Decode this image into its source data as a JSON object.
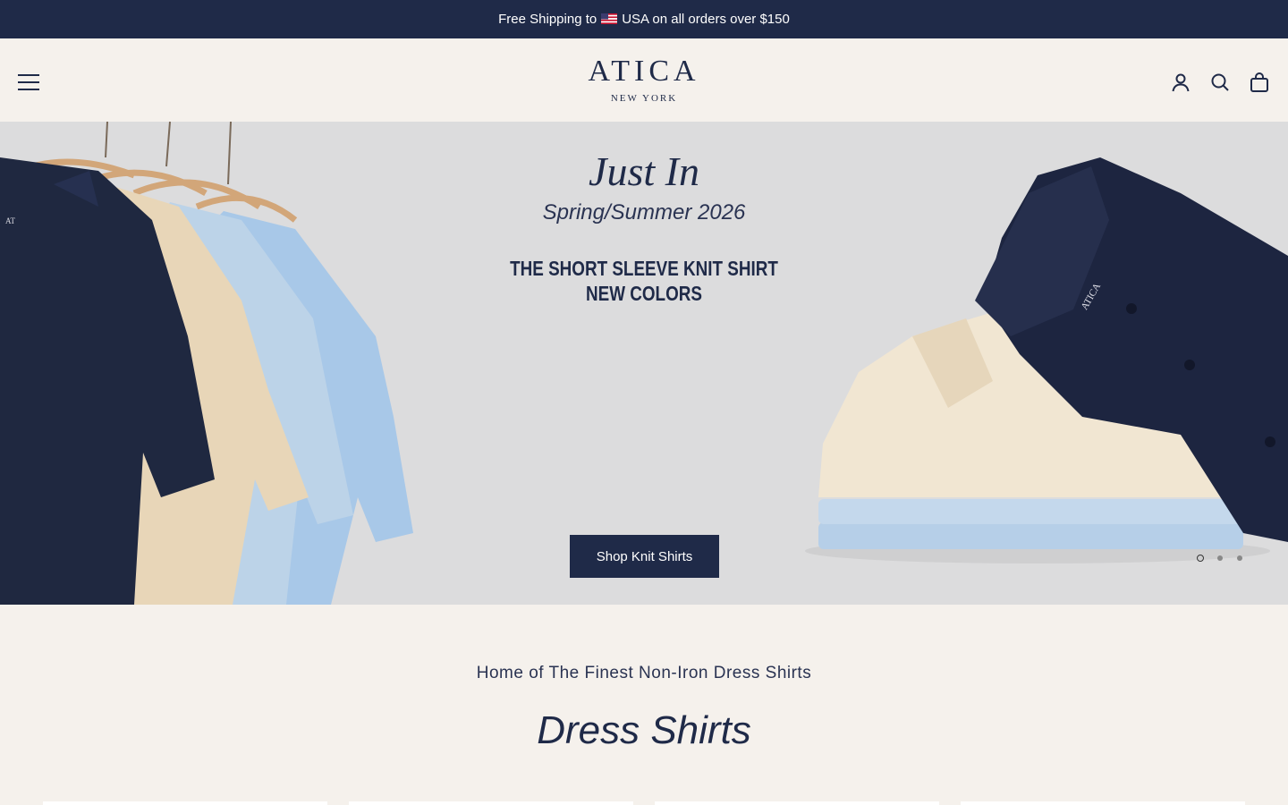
{
  "announcement": {
    "before": "Free Shipping to",
    "flag": "us-flag-icon",
    "after": "USA on all orders over $150"
  },
  "header": {
    "brand": "ATICA",
    "brand_sub": "NEW YORK",
    "icons": [
      "menu-icon",
      "account-icon",
      "search-icon",
      "cart-icon"
    ]
  },
  "hero": {
    "eyebrow": "Just In",
    "season": "Spring/Summer 2026",
    "heading_line1": "THE SHORT SLEEVE KNIT SHIRT",
    "heading_line2": "NEW COLORS",
    "cta": "Shop Knit Shirts",
    "slides_count": 3,
    "active_slide": 1
  },
  "section": {
    "tagline": "Home of The Finest Non-Iron Dress Shirts",
    "title": "Dress Shirts"
  },
  "colors": {
    "navy": "#1f2a48",
    "cream": "#f5f1ec",
    "hero_bg": "#dcdcdd"
  }
}
